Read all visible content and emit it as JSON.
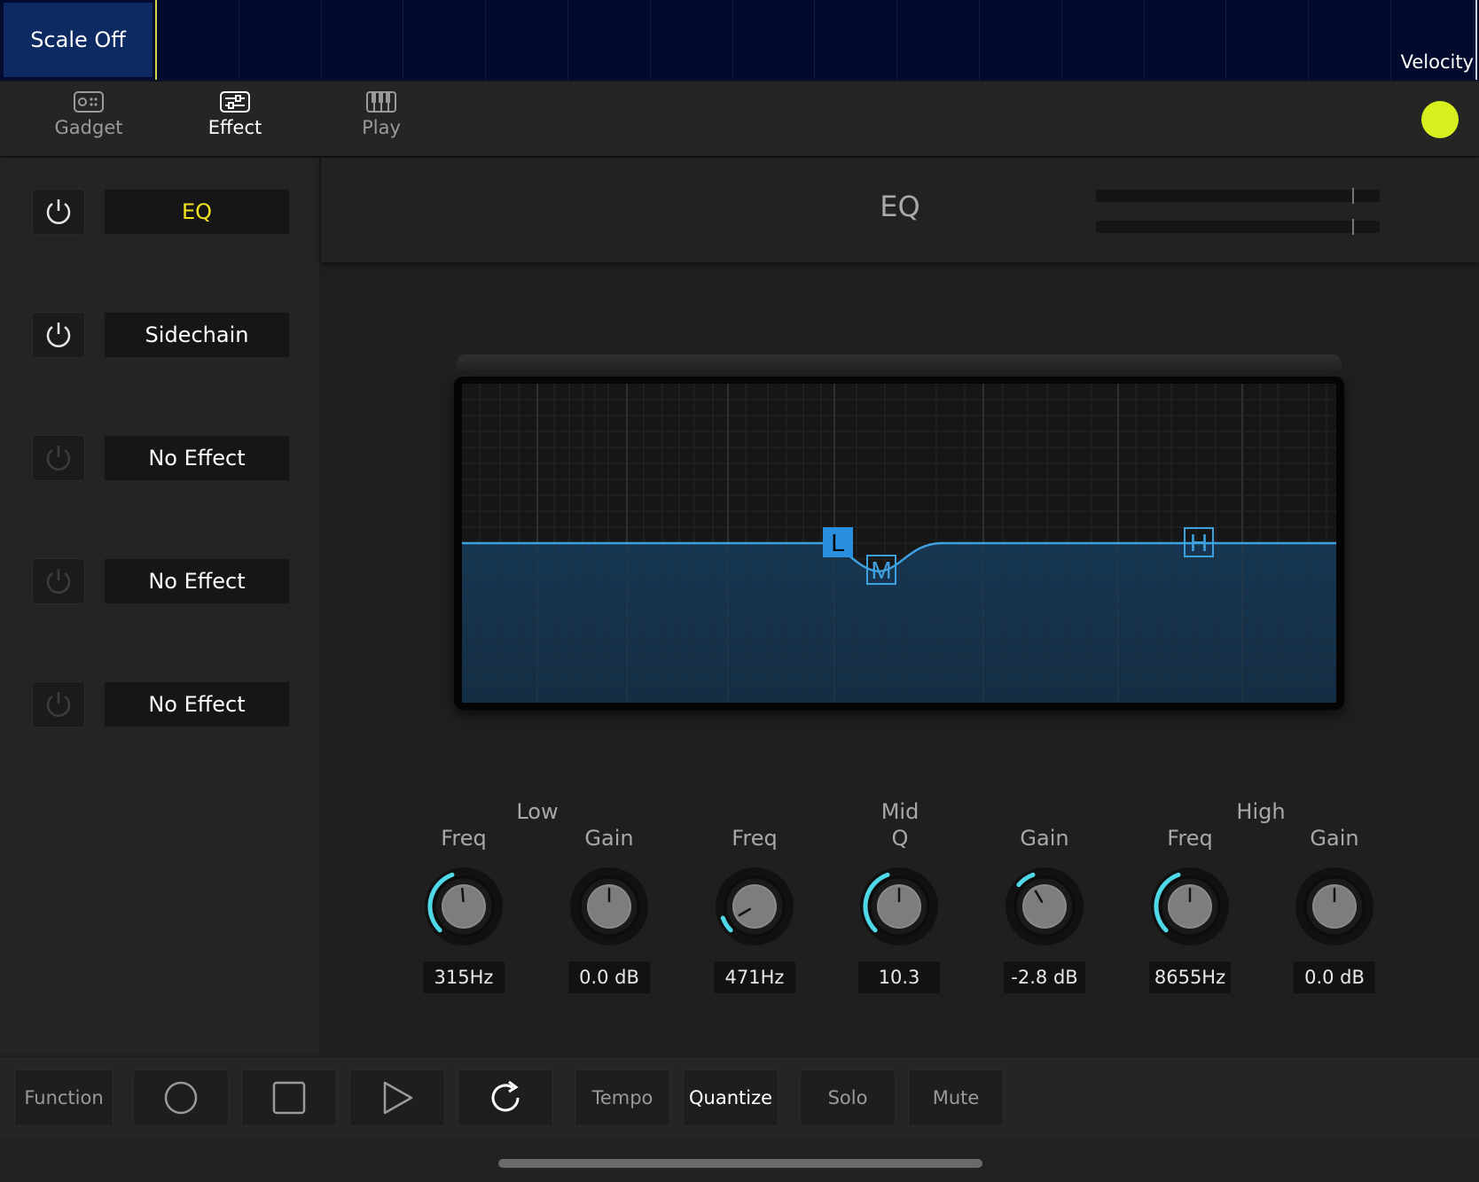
{
  "top_strip": {
    "scale_button": "Scale Off",
    "velocity_label": "Velocity"
  },
  "tabs": [
    {
      "label": "Gadget",
      "icon": "gadget-icon",
      "active": false
    },
    {
      "label": "Effect",
      "icon": "effect-icon",
      "active": true
    },
    {
      "label": "Play",
      "icon": "keyboard-icon",
      "active": false
    }
  ],
  "status_dot_color": "#d8f020",
  "effect_slots": [
    {
      "name": "EQ",
      "enabled": true,
      "active": true
    },
    {
      "name": "Sidechain",
      "enabled": true,
      "active": false
    },
    {
      "name": "No Effect",
      "enabled": false,
      "active": false
    },
    {
      "name": "No Effect",
      "enabled": false,
      "active": false
    },
    {
      "name": "No Effect",
      "enabled": false,
      "active": false
    }
  ],
  "eq": {
    "title": "EQ",
    "nodes": {
      "low": "L",
      "mid": "M",
      "high": "H"
    },
    "groups": {
      "low": "Low",
      "mid_line1": "Mid",
      "mid_line2": "Q",
      "high": "High"
    },
    "params": [
      {
        "label": "Freq",
        "value": "315Hz"
      },
      {
        "label": "Gain",
        "value": "0.0 dB"
      },
      {
        "label": "Freq",
        "value": "471Hz"
      },
      {
        "label": "",
        "value": "10.3"
      },
      {
        "label": "Gain",
        "value": "-2.8 dB"
      },
      {
        "label": "Freq",
        "value": "8655Hz"
      },
      {
        "label": "Gain",
        "value": "0.0 dB"
      }
    ]
  },
  "transport": {
    "function": "Function",
    "tempo": "Tempo",
    "quantize": "Quantize",
    "solo": "Solo",
    "mute": "Mute"
  }
}
